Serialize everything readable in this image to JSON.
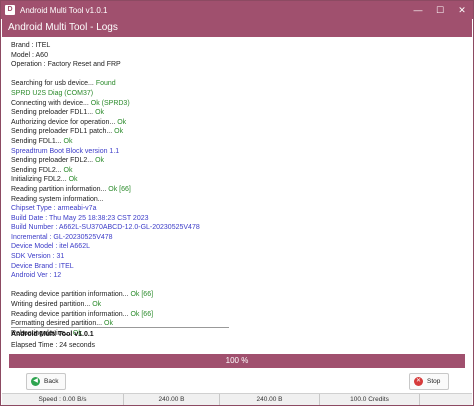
{
  "window": {
    "title": "Android Multi Tool v1.0.1",
    "icon_letter": "D",
    "controls": {
      "minimize": "—",
      "maximize": "☐",
      "close": "✕"
    }
  },
  "header": {
    "title": "Android Multi Tool - Logs"
  },
  "log": [
    {
      "parts": [
        {
          "text": "Brand : ITEL",
          "color": "dark"
        }
      ]
    },
    {
      "parts": [
        {
          "text": "Model : A60",
          "color": "dark"
        }
      ]
    },
    {
      "parts": [
        {
          "text": "Operation : Factory Reset and FRP",
          "color": "dark"
        }
      ]
    },
    {
      "parts": []
    },
    {
      "parts": [
        {
          "text": "Searching for usb device... ",
          "color": "dark"
        },
        {
          "text": "Found",
          "color": "ok"
        }
      ]
    },
    {
      "parts": [
        {
          "text": "SPRD U2S Diag (COM37)",
          "color": "ok"
        }
      ]
    },
    {
      "parts": [
        {
          "text": "Connecting with device... ",
          "color": "dark"
        },
        {
          "text": "Ok (SPRD3)",
          "color": "ok"
        }
      ]
    },
    {
      "parts": [
        {
          "text": "Sending preloader FDL1... ",
          "color": "dark"
        },
        {
          "text": "Ok",
          "color": "ok"
        }
      ]
    },
    {
      "parts": [
        {
          "text": "Authorizing device for operation... ",
          "color": "dark"
        },
        {
          "text": "Ok",
          "color": "ok"
        }
      ]
    },
    {
      "parts": [
        {
          "text": "Sending preloader FDL1 patch... ",
          "color": "dark"
        },
        {
          "text": "Ok",
          "color": "ok"
        }
      ]
    },
    {
      "parts": [
        {
          "text": "Sending FDL1... ",
          "color": "dark"
        },
        {
          "text": "Ok",
          "color": "ok"
        }
      ]
    },
    {
      "parts": [
        {
          "text": "Spreadtrum Boot Block version 1.1",
          "color": "blue"
        }
      ]
    },
    {
      "parts": [
        {
          "text": "Sending preloader FDL2... ",
          "color": "dark"
        },
        {
          "text": "Ok",
          "color": "ok"
        }
      ]
    },
    {
      "parts": [
        {
          "text": "Sending FDL2... ",
          "color": "dark"
        },
        {
          "text": "Ok",
          "color": "ok"
        }
      ]
    },
    {
      "parts": [
        {
          "text": "Initializing FDL2... ",
          "color": "dark"
        },
        {
          "text": "Ok",
          "color": "ok"
        }
      ]
    },
    {
      "parts": [
        {
          "text": "Reading partition information... ",
          "color": "dark"
        },
        {
          "text": "Ok [66]",
          "color": "ok"
        }
      ]
    },
    {
      "parts": [
        {
          "text": "Reading system information...",
          "color": "dark"
        }
      ]
    },
    {
      "parts": [
        {
          "text": "Chipset Type : armeabi-v7a",
          "color": "blue"
        }
      ]
    },
    {
      "parts": [
        {
          "text": "Build Date : Thu May 25 18:38:23 CST 2023",
          "color": "blue"
        }
      ]
    },
    {
      "parts": [
        {
          "text": "Build Number : A662L-SU370ABCD-12.0-GL-20230525V478",
          "color": "blue"
        }
      ]
    },
    {
      "parts": [
        {
          "text": "Incremental : GL-20230525V478",
          "color": "blue"
        }
      ]
    },
    {
      "parts": [
        {
          "text": "Device Model : itel A662L",
          "color": "blue"
        }
      ]
    },
    {
      "parts": [
        {
          "text": "SDK Version : 31",
          "color": "blue"
        }
      ]
    },
    {
      "parts": [
        {
          "text": "Device Brand : ITEL",
          "color": "blue"
        }
      ]
    },
    {
      "parts": [
        {
          "text": "Android Ver : 12",
          "color": "blue"
        }
      ]
    },
    {
      "parts": []
    },
    {
      "parts": [
        {
          "text": "Reading device partition information... ",
          "color": "dark"
        },
        {
          "text": "Ok [66]",
          "color": "ok"
        }
      ]
    },
    {
      "parts": [
        {
          "text": "Writing desired partition... ",
          "color": "dark"
        },
        {
          "text": "Ok",
          "color": "ok"
        }
      ]
    },
    {
      "parts": [
        {
          "text": "Reading device partition information... ",
          "color": "dark"
        },
        {
          "text": "Ok [66]",
          "color": "ok"
        }
      ]
    },
    {
      "parts": [
        {
          "text": "Formatting desired partition... ",
          "color": "dark"
        },
        {
          "text": "Ok",
          "color": "ok"
        }
      ]
    },
    {
      "parts": [
        {
          "text": "Rebooting device... ",
          "color": "dark"
        },
        {
          "text": "Ok",
          "color": "ok"
        }
      ]
    }
  ],
  "summary": {
    "title": "Android Multi Tool v1.0.1",
    "elapsed": "Elapsed Time : 24 seconds"
  },
  "progress": {
    "percent": 100,
    "label": "100 %"
  },
  "buttons": {
    "back": {
      "label": "Back",
      "icon": "back-arrow-icon"
    },
    "stop": {
      "label": "Stop",
      "icon": "stop-icon"
    }
  },
  "status_bar": {
    "speed": "Speed : 0.00 B/s",
    "transferred": "240.00 B",
    "total": "240.00 B",
    "credits": "100.0 Credits",
    "empty": ""
  },
  "colors": {
    "accent": "#a0506e",
    "ok": "#2a8a2a",
    "info": "#3c3cc8"
  }
}
